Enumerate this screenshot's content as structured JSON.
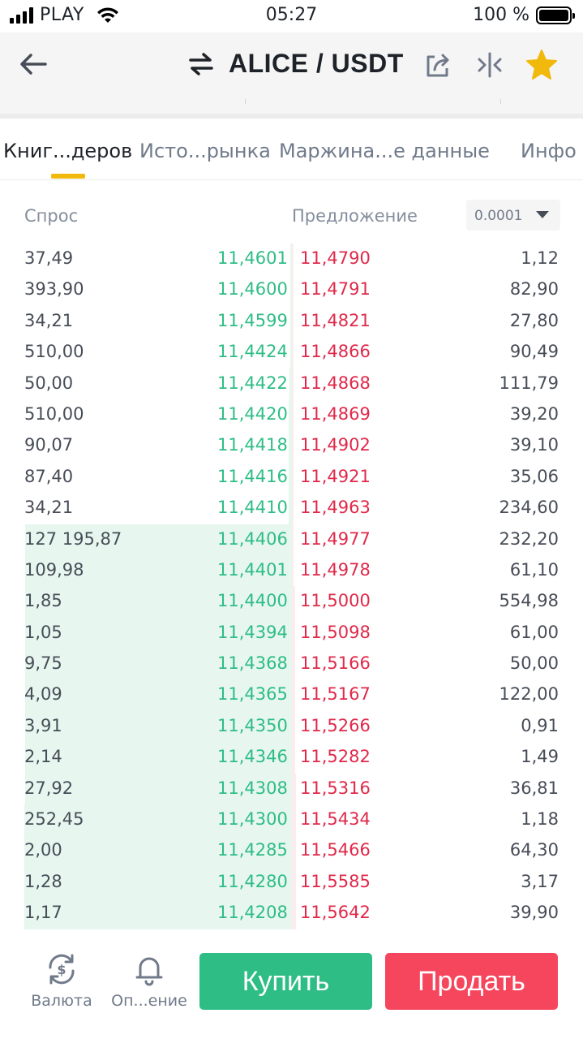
{
  "status_bar": {
    "carrier": "PLAY",
    "time": "05:27",
    "battery": "100 %",
    "battery_level": 1.0
  },
  "header": {
    "title": "ALICE / USDT",
    "icons": [
      "back-arrow-icon",
      "swap-arrows-icon",
      "share-icon",
      "compare-icon",
      "star-icon"
    ],
    "star_color": "#f0b90b"
  },
  "tabs": [
    {
      "label": "Книг...деров",
      "active": true
    },
    {
      "label": "Исто...рынка",
      "active": false
    },
    {
      "label": "Маржина...е данные",
      "active": false
    },
    {
      "label": "Инфо",
      "active": false
    }
  ],
  "order_book": {
    "bid_label": "Спрос",
    "ask_label": "Предложение",
    "precision": "0.0001",
    "colors": {
      "bid": "#2ebd85",
      "ask": "#e0294a"
    },
    "rows": [
      {
        "bid_amount": "37,49",
        "bid_price": "11,4601",
        "ask_price": "11,4790",
        "ask_amount": "1,12"
      },
      {
        "bid_amount": "393,90",
        "bid_price": "11,4600",
        "ask_price": "11,4791",
        "ask_amount": "82,90"
      },
      {
        "bid_amount": "34,21",
        "bid_price": "11,4599",
        "ask_price": "11,4821",
        "ask_amount": "27,80"
      },
      {
        "bid_amount": "510,00",
        "bid_price": "11,4424",
        "ask_price": "11,4866",
        "ask_amount": "90,49"
      },
      {
        "bid_amount": "50,00",
        "bid_price": "11,4422",
        "ask_price": "11,4868",
        "ask_amount": "111,79"
      },
      {
        "bid_amount": "510,00",
        "bid_price": "11,4420",
        "ask_price": "11,4869",
        "ask_amount": "39,20"
      },
      {
        "bid_amount": "90,07",
        "bid_price": "11,4418",
        "ask_price": "11,4902",
        "ask_amount": "39,10"
      },
      {
        "bid_amount": "87,40",
        "bid_price": "11,4416",
        "ask_price": "11,4921",
        "ask_amount": "35,06"
      },
      {
        "bid_amount": "34,21",
        "bid_price": "11,4410",
        "ask_price": "11,4963",
        "ask_amount": "234,60"
      },
      {
        "bid_amount": "127 195,87",
        "bid_price": "11,4406",
        "ask_price": "11,4977",
        "ask_amount": "232,20"
      },
      {
        "bid_amount": "109,98",
        "bid_price": "11,4401",
        "ask_price": "11,4978",
        "ask_amount": "61,10"
      },
      {
        "bid_amount": "1,85",
        "bid_price": "11,4400",
        "ask_price": "11,5000",
        "ask_amount": "554,98"
      },
      {
        "bid_amount": "1,05",
        "bid_price": "11,4394",
        "ask_price": "11,5098",
        "ask_amount": "61,00"
      },
      {
        "bid_amount": "9,75",
        "bid_price": "11,4368",
        "ask_price": "11,5166",
        "ask_amount": "50,00"
      },
      {
        "bid_amount": "4,09",
        "bid_price": "11,4365",
        "ask_price": "11,5167",
        "ask_amount": "122,00"
      },
      {
        "bid_amount": "3,91",
        "bid_price": "11,4350",
        "ask_price": "11,5266",
        "ask_amount": "0,91"
      },
      {
        "bid_amount": "2,14",
        "bid_price": "11,4346",
        "ask_price": "11,5282",
        "ask_amount": "1,49"
      },
      {
        "bid_amount": "27,92",
        "bid_price": "11,4308",
        "ask_price": "11,5316",
        "ask_amount": "36,81"
      },
      {
        "bid_amount": "252,45",
        "bid_price": "11,4300",
        "ask_price": "11,5434",
        "ask_amount": "1,18"
      },
      {
        "bid_amount": "2,00",
        "bid_price": "11,4285",
        "ask_price": "11,5466",
        "ask_amount": "64,30"
      },
      {
        "bid_amount": "1,28",
        "bid_price": "11,4280",
        "ask_price": "11,5585",
        "ask_amount": "3,17"
      },
      {
        "bid_amount": "1,17",
        "bid_price": "11,4208",
        "ask_price": "11,5642",
        "ask_amount": "39,90"
      }
    ]
  },
  "bottom_bar": {
    "currency_label": "Валюта",
    "alert_label": "Оп...ение",
    "buy_label": "Купить",
    "sell_label": "Продать",
    "buy_color": "#2ebd85",
    "sell_color": "#f6465d"
  }
}
